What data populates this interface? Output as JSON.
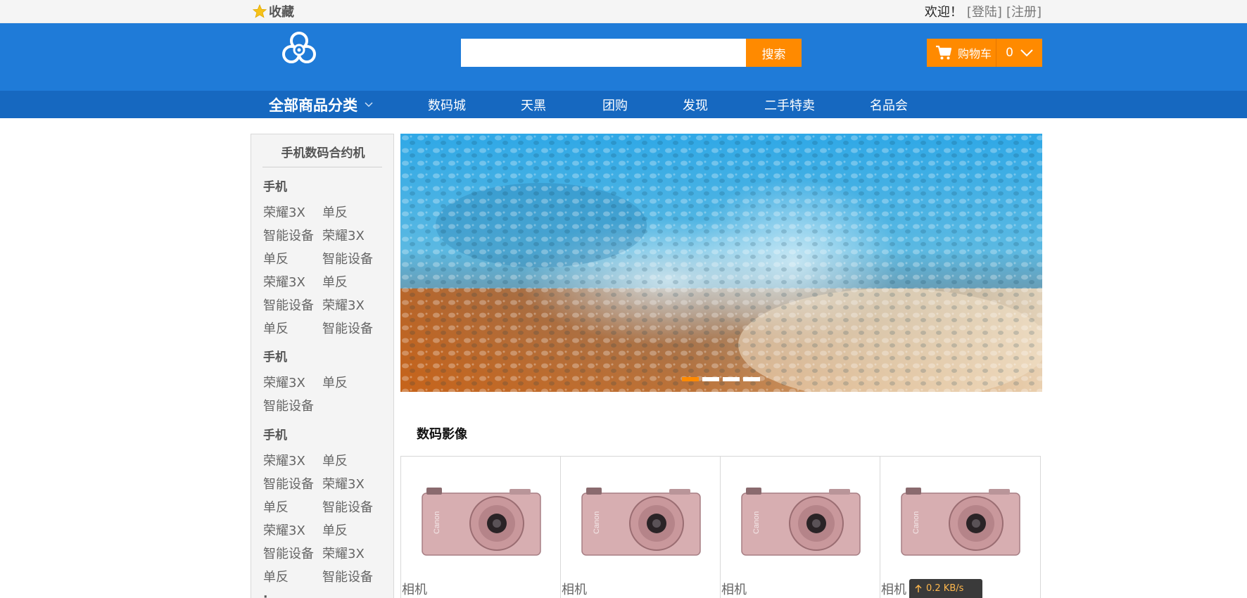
{
  "topbar": {
    "favorite_label": "收藏",
    "favorite_icon": "star-icon",
    "welcome_text": "欢迎！",
    "login_label": "[登陆]",
    "register_label": "[注册]"
  },
  "header": {
    "logo_icon": "biohazard-logo-icon",
    "search_placeholder": "",
    "search_button": "搜索",
    "cart_label": "购物车",
    "cart_count": "0",
    "cart_icon": "cart-icon"
  },
  "nav": {
    "all_categories": "全部商品分类",
    "items": [
      "数码城",
      "天黑",
      "团购",
      "发现",
      "二手特卖",
      "名品会"
    ]
  },
  "sidebar": {
    "title": "手机数码合约机",
    "sections": [
      {
        "heading": "手机",
        "links": [
          "荣耀3X",
          "单反",
          "智能设备",
          "荣耀3X",
          "单反",
          "智能设备",
          "荣耀3X",
          "单反",
          "智能设备",
          "荣耀3X",
          "单反",
          "智能设备"
        ]
      },
      {
        "heading": "手机",
        "links": [
          "荣耀3X",
          "单反",
          "智能设备"
        ]
      },
      {
        "heading": "手机",
        "links": [
          "荣耀3X",
          "单反",
          "智能设备",
          "荣耀3X",
          "单反",
          "智能设备",
          "荣耀3X",
          "单反",
          "智能设备",
          "荣耀3X",
          "单反",
          "智能设备"
        ]
      }
    ]
  },
  "banner": {
    "slide_count": 4,
    "active_slide": 1
  },
  "products": {
    "section_title": "数码影像",
    "items": [
      {
        "name": "相机"
      },
      {
        "name": "相机"
      },
      {
        "name": "相机"
      },
      {
        "name": "相机"
      }
    ]
  },
  "speed_widget": {
    "text": "0.2 KB/s"
  },
  "colors": {
    "header_blue": "#1f7bd8",
    "nav_blue": "#1668c0",
    "accent_orange": "#ff8a00"
  }
}
